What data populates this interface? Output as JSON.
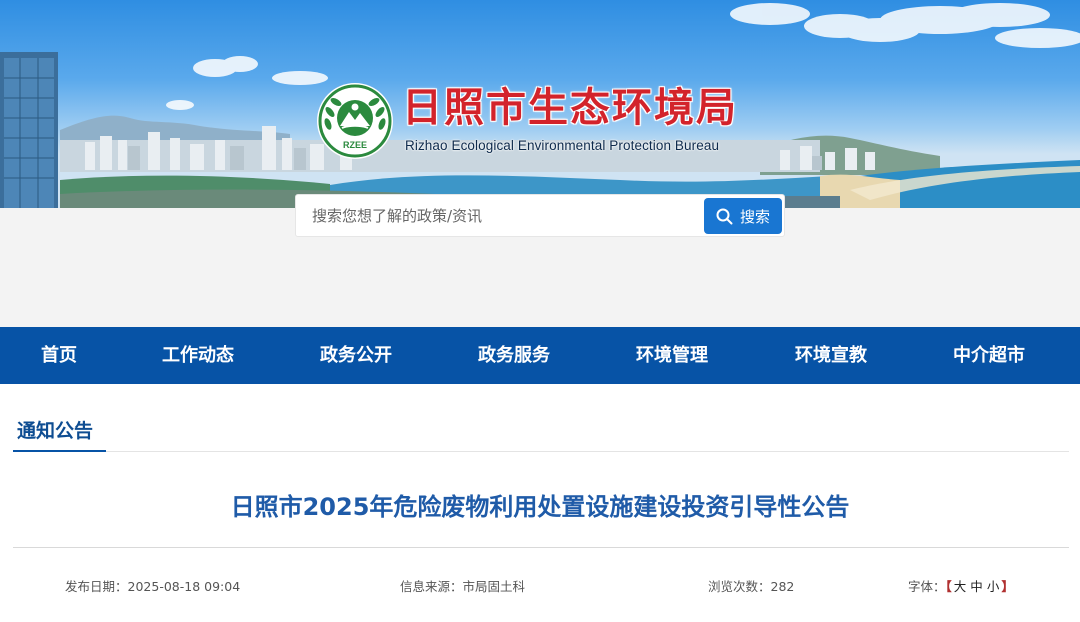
{
  "header": {
    "title_cn": "日照市生态环境局",
    "title_en": "Rizhao Ecological Environmental Protection Bureau",
    "logo_text": "RZEE",
    "brand_color": "#d3232b"
  },
  "search": {
    "placeholder": "搜索您想了解的政策/资讯",
    "button_label": "搜索",
    "button_color": "#1976d2"
  },
  "nav": {
    "color": "#0753a6",
    "items": [
      "首页",
      "工作动态",
      "政务公开",
      "政务服务",
      "环境管理",
      "环境宣教",
      "中介超市"
    ]
  },
  "section": {
    "title": "通知公告"
  },
  "article": {
    "title": "日照市2025年危险废物利用处置设施建设投资引导性公告",
    "publish_label": "发布日期：",
    "publish_value": "2025-08-18 09:04",
    "source_label": "信息来源：",
    "source_value": "市局固土科",
    "views_label": "浏览次数：",
    "views_value": "282",
    "font_label": "字体：",
    "font_open": "【",
    "font_close": "】",
    "font_large": "大",
    "font_medium": "中",
    "font_small": "小"
  }
}
